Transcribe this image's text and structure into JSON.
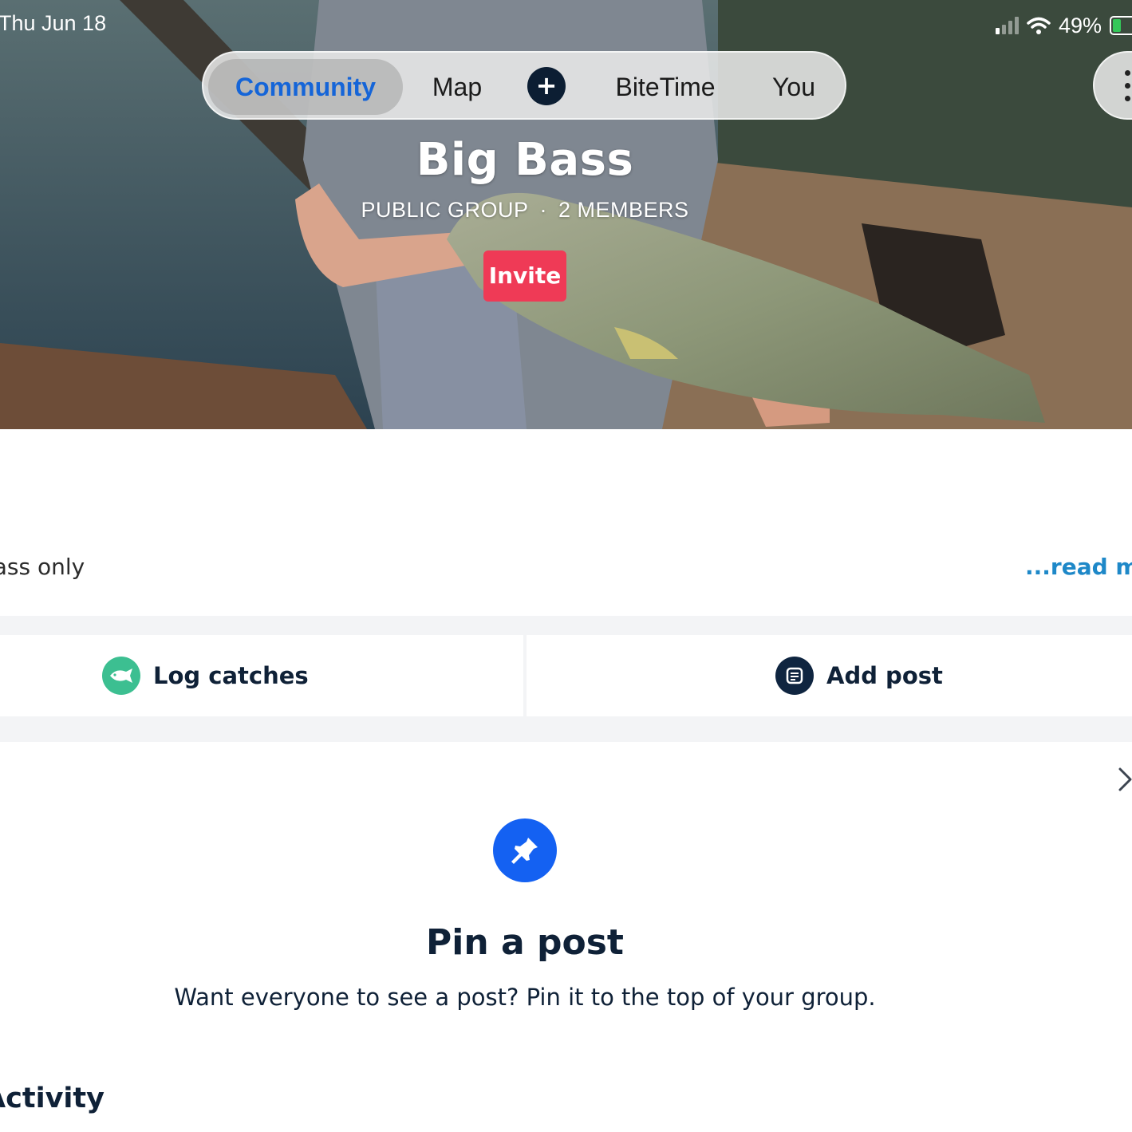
{
  "status_bar": {
    "time": "Thu Jun 18",
    "battery": "49%"
  },
  "nav": {
    "tabs": [
      {
        "label": "Community",
        "active": true
      },
      {
        "label": "Map",
        "active": false
      },
      {
        "label": "BiteTime",
        "active": false
      },
      {
        "label": "You",
        "active": false
      }
    ],
    "add_label": "+"
  },
  "group": {
    "name": "Big Bass",
    "visibility": "PUBLIC GROUP",
    "separator": "·",
    "members": "2 MEMBERS",
    "invite_label": "Invite",
    "description": "bass only",
    "read_more": "...read more"
  },
  "actions": {
    "log_catches": "Log catches",
    "add_post": "Add post"
  },
  "pin_prompt": {
    "title": "Pin a post",
    "subtitle": "Want everyone to see a post? Pin it to the top of your group."
  },
  "activity": {
    "heading": "Activity"
  },
  "colors": {
    "accent_blue": "#1565d8",
    "invite_red": "#ef3a56",
    "log_green": "#3cbf91",
    "pin_blue": "#1461f2",
    "link_blue": "#1e88c8",
    "navy": "#0f2137"
  },
  "icons": [
    "signal-icon",
    "wifi-icon",
    "battery-icon",
    "plus-icon",
    "more-icon",
    "fish-icon",
    "post-icon",
    "close-icon",
    "pin-icon"
  ]
}
